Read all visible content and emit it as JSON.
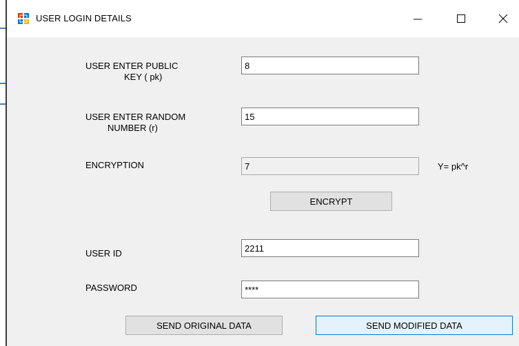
{
  "window": {
    "title": "USER LOGIN DETAILS"
  },
  "form": {
    "public_key": {
      "label_line1": "USER ENTER PUBLIC",
      "label_line2": "KEY ( pk)",
      "value": "8"
    },
    "random_number": {
      "label_line1": "USER ENTER RANDOM",
      "label_line2": "NUMBER (r)",
      "value": "15"
    },
    "encryption": {
      "label": "ENCRYPTION",
      "value": "7",
      "formula": "Y= pk^r"
    },
    "encrypt_button": "ENCRYPT",
    "user_id": {
      "label": "USER ID",
      "value": "2211"
    },
    "password": {
      "label": "PASSWORD",
      "value": "****"
    },
    "send_original_button": "SEND ORIGINAL DATA",
    "send_modified_button": "SEND MODIFIED DATA"
  },
  "icons": {
    "app": "app-window-icon",
    "minimize": "minimize-icon",
    "maximize": "maximize-icon",
    "close": "close-icon"
  },
  "colors": {
    "window_bg": "#f0f0f0",
    "titlebar_bg": "#ffffff",
    "focus_border": "#0078d7",
    "button_bg": "#e1e1e1"
  }
}
